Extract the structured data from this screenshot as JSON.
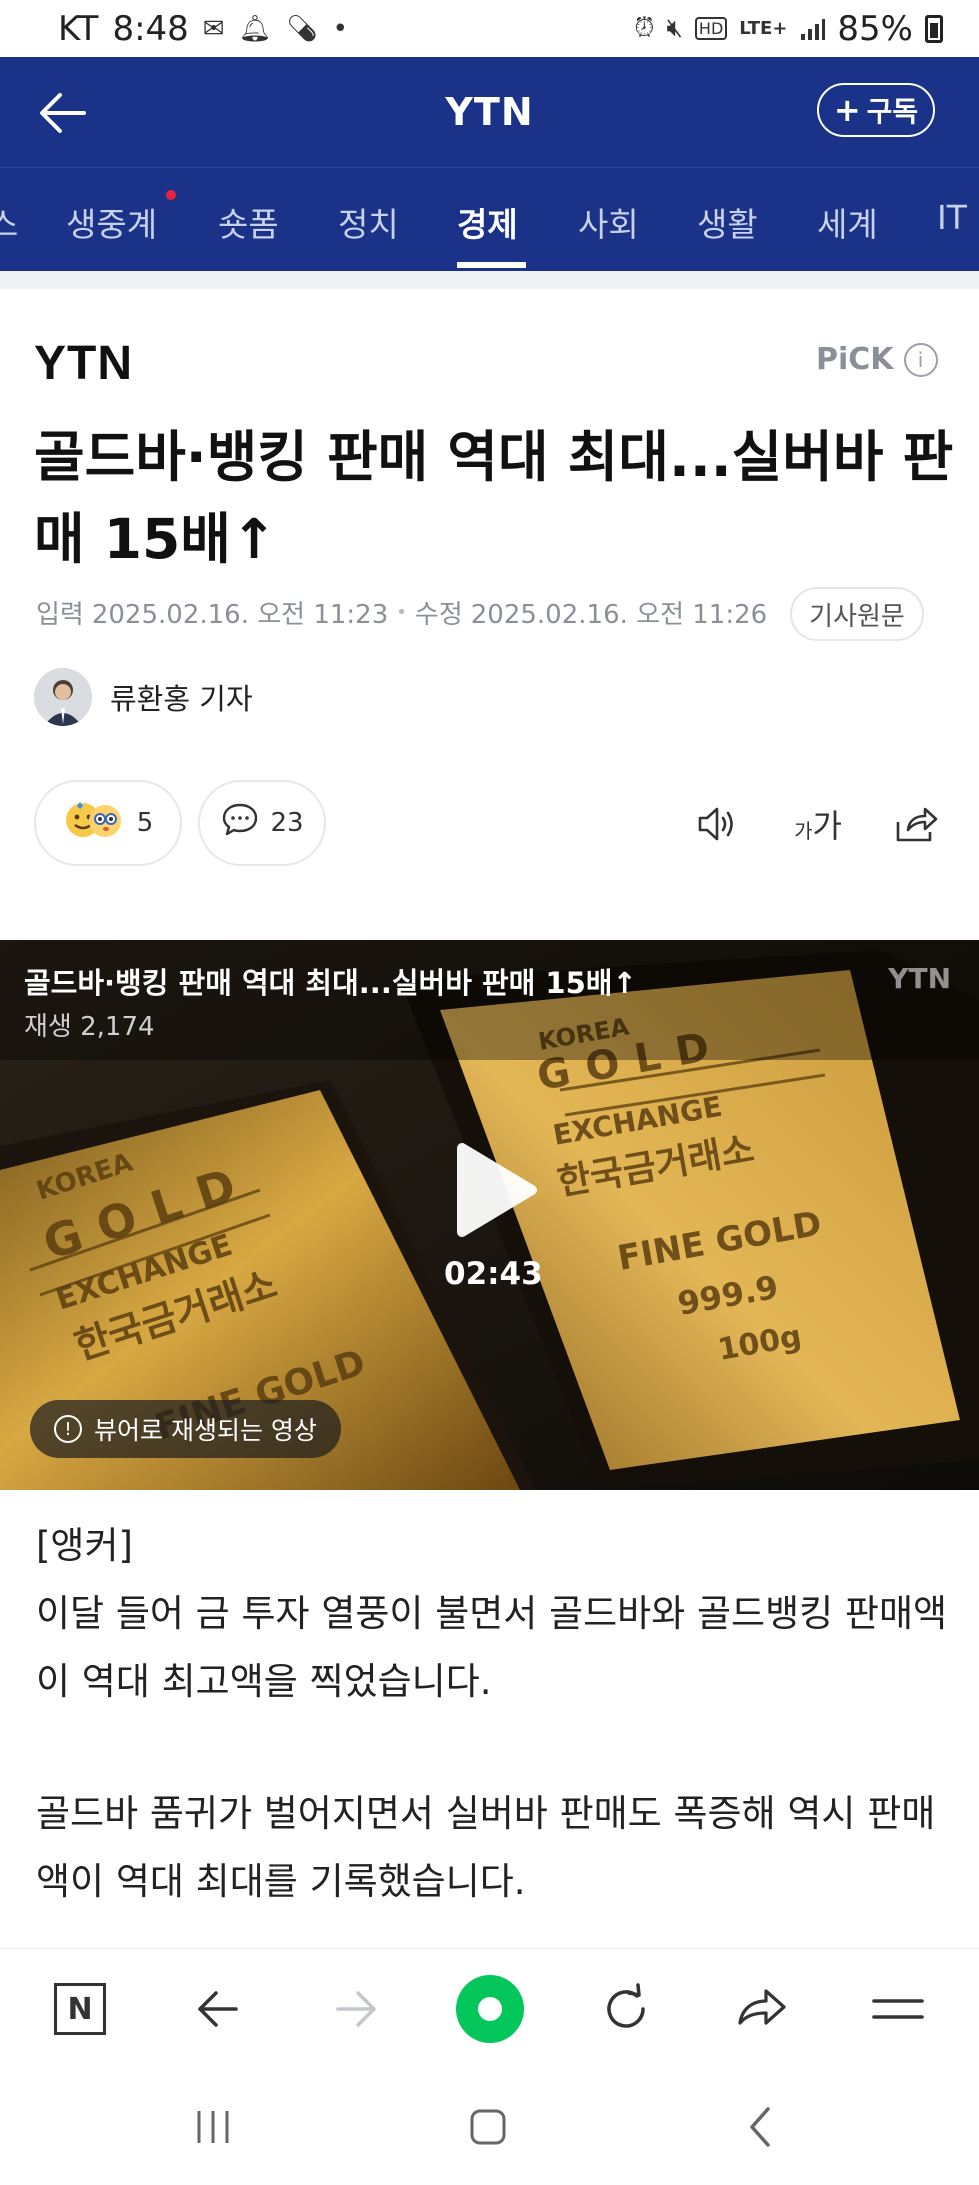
{
  "status_bar": {
    "carrier": "KT",
    "time": "8:48",
    "dot": "•",
    "network": "LTE+",
    "battery": "85%"
  },
  "header": {
    "title": "YTN",
    "subscribe_label": "구독"
  },
  "nav_tabs": {
    "items": [
      {
        "label": "스"
      },
      {
        "label": "생중계"
      },
      {
        "label": "숏폼"
      },
      {
        "label": "정치"
      },
      {
        "label": "경제"
      },
      {
        "label": "사회"
      },
      {
        "label": "생활"
      },
      {
        "label": "세계"
      },
      {
        "label": "IT"
      }
    ],
    "active": "경제"
  },
  "article": {
    "press_logo": "YTN",
    "pick_label": "PiCK",
    "pick_info": "i",
    "headline": "골드바·뱅킹 판매 역대 최대...실버바 판매 15배↑",
    "input_label": "입력",
    "input_date": "2025.02.16. 오전 11:23",
    "modified_label": "수정",
    "modified_date": "2025.02.16. 오전 11:26",
    "original_button": "기사원문",
    "author": "류환홍 기자",
    "reaction_count": "5",
    "comment_count": "23",
    "font_size_label_small": "가",
    "font_size_label_large": "가"
  },
  "video": {
    "title": "골드바·뱅킹 판매 역대 최대...실버바 판매 15배↑",
    "plays": "재생 2,174",
    "watermark": "YTN",
    "duration": "02:43",
    "viewer_notice": "뷰어로 재생되는 영상",
    "gold_lettering": [
      "KOREA",
      "GOLD",
      "EXCHANGE",
      "한국금거래소",
      "FINE GOLD",
      "999.9",
      "100g"
    ]
  },
  "body": {
    "paragraphs": [
      "[앵커]",
      "이달 들어 금 투자 열풍이 불면서 골드바와 골드뱅킹 판매액이 역대 최고액을 찍었습니다.",
      "골드바 품귀가 벌어지면서 실버바 판매도 폭증해 역시 판매액이 역대 최대를 기록했습니다."
    ]
  },
  "browser_bar": {
    "home_label": "N"
  },
  "colors": {
    "header_bg": "#1a3288",
    "accent_green": "#03c75a",
    "live_dot": "#e8243c"
  }
}
